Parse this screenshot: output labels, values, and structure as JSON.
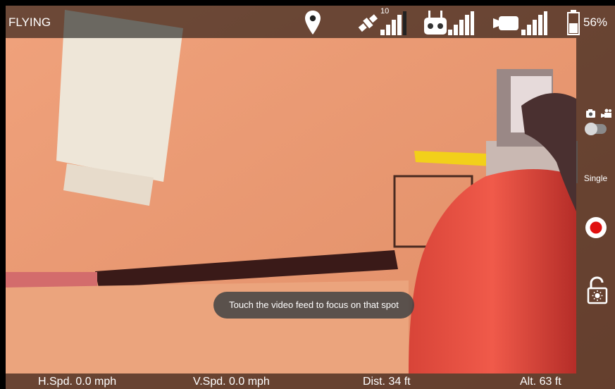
{
  "top_bar": {
    "status": "FLYING",
    "gps_satellites": "10",
    "battery_percent": "56%",
    "icons": [
      "location-pin-icon",
      "satellite-icon",
      "remote-controller-icon",
      "video-camera-icon",
      "battery-icon"
    ]
  },
  "side_bar": {
    "shoot_mode": "Single",
    "icons": [
      "photo-camera-icon",
      "video-mode-icon",
      "record-button-icon",
      "lock-icon"
    ]
  },
  "toast": {
    "message": "Touch the video feed to focus on that spot"
  },
  "telemetry": {
    "h_speed": "H.Spd. 0.0 mph",
    "v_speed": "V.Spd. 0.0 mph",
    "distance": "Dist. 34 ft",
    "altitude": "Alt. 63 ft"
  },
  "colors": {
    "record": "#e01010",
    "bar_background": "#000000"
  }
}
